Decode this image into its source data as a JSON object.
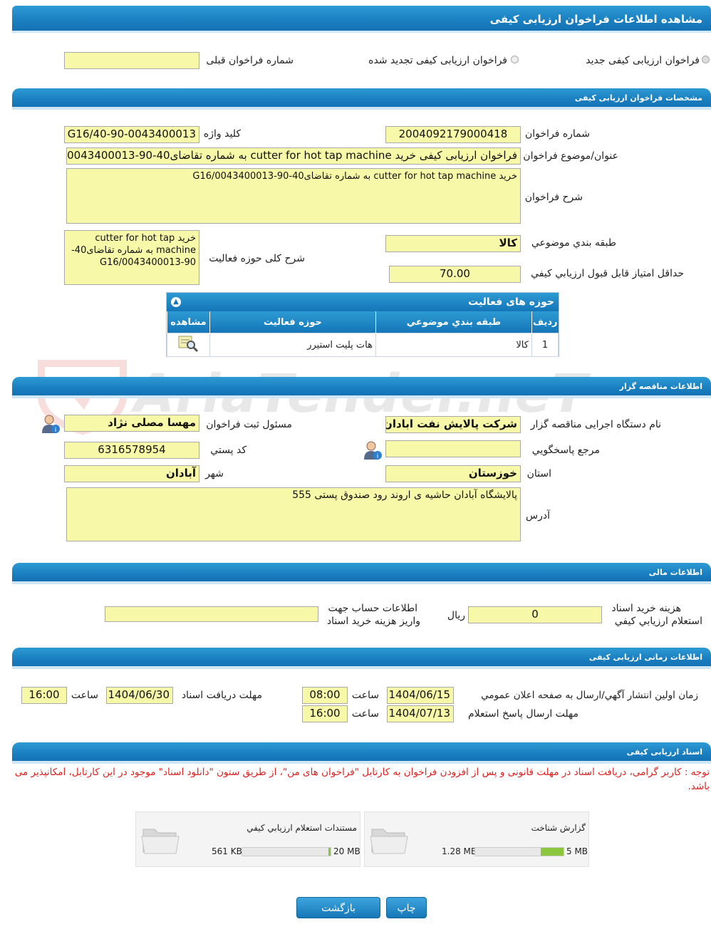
{
  "page_title": "مشاهده اطلاعات فراخوان ارزيابی کيفی",
  "radios": {
    "new_label": "فراخوان ارزيابی کيفی جديد",
    "renewed_label": "فراخوان ارزيابی کيفی تجديد شده",
    "prev_number_label": "شماره فراخوان قبلی",
    "prev_number_value": ""
  },
  "spec": {
    "header": "مشخصات فراخوان ارزيابی کيفی",
    "number_label": "شماره فراخوان",
    "number_value": "2004092179000418",
    "keyword_label": "کليد واژه",
    "keyword_value": "G16/40-90-0043400013",
    "title_label": "عنوان/موضوع فراخوان",
    "title_value": "فراخوان ارزيابی کيفی خريد cutter for hot tap machine  به شماره تقاضای40-90-0043400013",
    "desc_label": "شرح فراخوان",
    "desc_value": "خريد cutter for hot tap machine  به شماره تقاضای40-90-G16/0043400013",
    "category_label": "طبقه بندي موضوعي",
    "category_value": "کالا",
    "activity_desc_label": "شرح کلی حوزه فعاليت",
    "activity_desc_value": "خريد cutter for hot tap machine  به شماره تقاضای40-90-G16/0043400013",
    "min_score_label": "حداقل امتياز قابل قبول ارزيابي کيفي",
    "min_score_value": "70.00"
  },
  "activity_table": {
    "title": "حوزه های فعاليت",
    "headers": [
      "رديف",
      "طبقه بندي موضوعي",
      "حوزه فعاليت",
      "مشاهده"
    ],
    "rows": [
      [
        "1",
        "کالا",
        "هات پليت استيرر"
      ]
    ]
  },
  "org": {
    "header": "اطلاعات مناقصه گزار",
    "exec_label": "نام دستگاه اجرايی مناقصه گزار",
    "exec_value": "شرکت پالايش نفت ابادان",
    "registrar_label": "مسئول ثبت فراخوان",
    "registrar_value": "مهسا مصلی نژاد",
    "reference_label": "مرجع پاسخگويي",
    "reference_value": "",
    "postal_label": "کد پستي",
    "postal_value": "6316578954",
    "province_label": "استان",
    "province_value": "خوزستان",
    "city_label": "شهر",
    "city_value": "آبادان",
    "address_label": "آدرس",
    "address_value": "پالايشگاه آبادان حاشيه ی اروند رود صندوق پستی 555"
  },
  "finance": {
    "header": "اطلاعات مالی",
    "fee_label_1": "هزينه خريد اسناد",
    "fee_label_2": "استعلام ارزيابي کيفي",
    "fee_value": "0",
    "currency": "ريال",
    "account_label_1": "اطلاعات حساب جهت",
    "account_label_2": "واريز هزينه خريد اسناد",
    "account_value": ""
  },
  "timing": {
    "header": "اطلاعات زمانی ارزيابی کيفی",
    "publish_label": "زمان اولين انتشار آگهي/ارسال به صفحه اعلان عمومي",
    "publish_date": "1404/06/15",
    "publish_time": "08:00",
    "receive_label": "مهلت دريافت اسناد",
    "receive_date": "1404/06/30",
    "receive_time": "16:00",
    "answer_label": "مهلت ارسال پاسخ استعلام",
    "answer_date": "1404/07/13",
    "answer_time": "16:00",
    "time_label": "ساعت"
  },
  "docs": {
    "header": "اسناد ارزيابی کيفی",
    "note": "توجه : کاربر گرامی، دريافت اسناد در مهلت قانونی و پس از افزودن فراخوان به کارتابل \"فراخوان های من\"، از طريق ستون \"دانلود اسناد\" موجود در اين کارتابل، امکانپذير می باشد.",
    "files": [
      {
        "name": "گزارش شناخت",
        "size": "1.28 MB",
        "max": "5 MB",
        "fill": 0.256
      },
      {
        "name": "مستندات استعلام ارزيابي کيفي",
        "size": "561 KB",
        "max": "20 MB",
        "fill": 0.027
      }
    ]
  },
  "buttons": {
    "print": "چاپ",
    "back": "بازگشت"
  },
  "watermark": "AriaTender.neT"
}
